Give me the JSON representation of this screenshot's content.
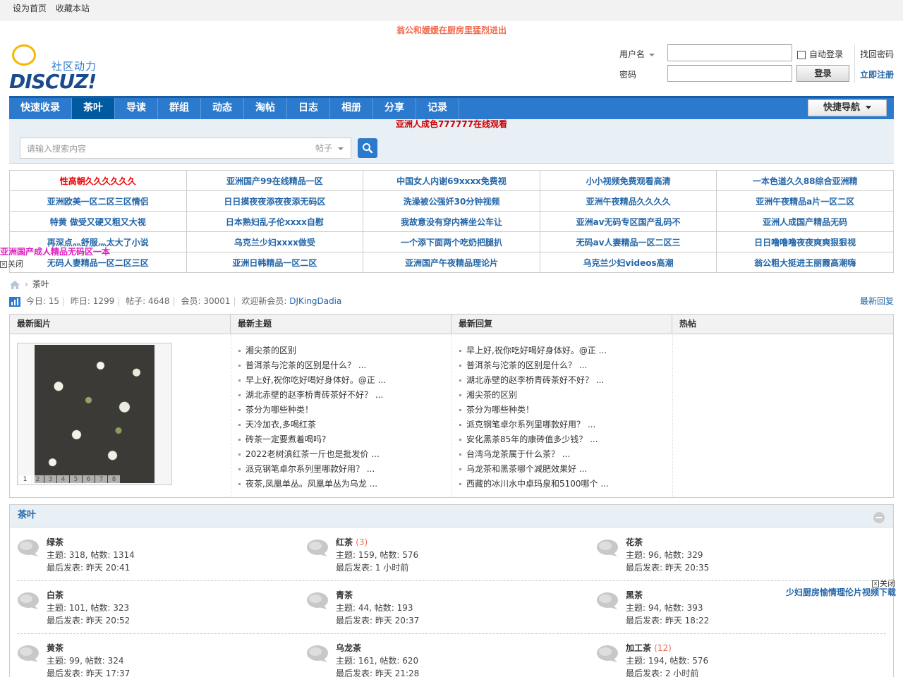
{
  "topbar": {
    "set_home": "设为首页",
    "bookmark": "收藏本站"
  },
  "top_ad": "翁公和媛媛在厨房里猛烈进出",
  "logo": {
    "slogan": "社区动力",
    "word": "DISCUZ!"
  },
  "login": {
    "username_label": "用户名",
    "password_label": "密码",
    "auto_login": "自动登录",
    "login_button": "登录",
    "find_password": "找回密码",
    "register": "立即注册"
  },
  "nav": {
    "items": [
      "快速收录",
      "茶叶",
      "导读",
      "群组",
      "动态",
      "淘帖",
      "日志",
      "相册",
      "分享",
      "记录"
    ],
    "quick_nav": "快捷导航"
  },
  "nav_ad": "亚洲人成色777777在线观看",
  "search": {
    "placeholder": "请输入搜索内容",
    "scope": "帖子"
  },
  "link_ads": [
    [
      "性高朝久久久久久久",
      "亚洲国产99在线精品一区",
      "中国女人内谢69xxxx免费视",
      "小小视频免费观看高清",
      "一本色道久久88综合亚洲精"
    ],
    [
      "亚洲欧美一区二区三区情侣",
      "日日摸夜夜添夜夜添无码区",
      "洗澡被公强奷30分钟视频",
      "亚洲午夜精品久久久久",
      "亚洲午夜精品a片一区二区"
    ],
    [
      "特黄 做受又硬又粗又大视",
      "日本熟妇乱子伦xxxx自慰",
      "我故意没有穿内裤坐公车让",
      "亚洲av无码专区国产乱码不",
      "亚洲人成国产精品无码"
    ],
    [
      "再深点灬舒服灬太大了小说",
      "乌克兰少妇xxxx做受",
      "一个添下面两个吃奶把腿扒",
      "无码av人妻精品一区二区三",
      "日日噜噜噜夜夜爽爽狠狠视"
    ],
    [
      "无码人妻精品一区二区三区",
      "亚洲日韩精品一区二区",
      "亚洲国产午夜精品理论片",
      "乌克兰少妇videos高潮",
      "翁公粗大挺进王丽霞高潮嗨"
    ]
  ],
  "float_left": {
    "text": "亚洲国产成人精品无码区一本",
    "close": "关闭"
  },
  "float_right": {
    "text": "少妇厨房愉情理伦片视频下载",
    "close": "关闭"
  },
  "breadcrumb": {
    "current": "茶叶"
  },
  "stats": {
    "today_label": "今日:",
    "today": "15",
    "yesterday_label": "昨日:",
    "yesterday": "1299",
    "posts_label": "帖子:",
    "posts": "4648",
    "members_label": "会员:",
    "members": "30001",
    "welcome_label": "欢迎新会员:",
    "new_member": "DJKingDadia",
    "latest_replies": "最新回复"
  },
  "widget": {
    "headers": [
      "最新图片",
      "最新主题",
      "最新回复",
      "热帖"
    ],
    "pager": [
      "1",
      "2",
      "3",
      "4",
      "5",
      "6",
      "7",
      "8"
    ],
    "latest_topics": [
      "湘尖茶的区别",
      "普洱茶与沱茶的区别是什么？ ...",
      "早上好,祝你吃好喝好身体好。@正 ...",
      "湖北赤壁的赵李桥青砖茶好不好？ ...",
      "茶分为哪些种类！",
      "天冷加衣,多喝红茶",
      "砖茶一定要煮着喝吗?",
      "2022老树滇红茶一斤也是批发价 ...",
      "派克钢笔卓尔系列里哪款好用？ ...",
      "夜茶,凤凰单丛。凤凰单丛为乌龙 ..."
    ],
    "latest_replies": [
      "早上好,祝你吃好喝好身体好。@正 ...",
      "普洱茶与沱茶的区别是什么？ ...",
      "湖北赤壁的赵李桥青砖茶好不好？ ...",
      "湘尖茶的区别",
      "茶分为哪些种类！",
      "派克钢笔卓尔系列里哪款好用？ ...",
      "安化黑茶85年的康砖值多少钱？ ...",
      "台湾乌龙茶属于什么茶？ ...",
      "乌龙茶和黑茶哪个减肥效果好 ...",
      "西藏的冰川水中卓玛泉和5100哪个 ..."
    ]
  },
  "forums": {
    "title": "茶叶",
    "items": [
      {
        "name": "绿茶",
        "new": "",
        "stats": "主题: 318, 帖数: 1314",
        "last": "最后发表: 昨天 20:41"
      },
      {
        "name": "红茶",
        "new": "(3)",
        "stats": "主题: 159, 帖数: 576",
        "last": "最后发表: 1 小时前"
      },
      {
        "name": "花茶",
        "new": "",
        "stats": "主题: 96, 帖数: 329",
        "last": "最后发表: 昨天 20:35"
      },
      {
        "name": "白茶",
        "new": "",
        "stats": "主题: 101, 帖数: 323",
        "last": "最后发表: 昨天 20:52"
      },
      {
        "name": "青茶",
        "new": "",
        "stats": "主题: 44, 帖数: 193",
        "last": "最后发表: 昨天 20:37"
      },
      {
        "name": "黑茶",
        "new": "",
        "stats": "主题: 94, 帖数: 393",
        "last": "最后发表: 昨天 18:22"
      },
      {
        "name": "黄茶",
        "new": "",
        "stats": "主题: 99, 帖数: 324",
        "last": "最后发表: 昨天 17:37"
      },
      {
        "name": "乌龙茶",
        "new": "",
        "stats": "主题: 161, 帖数: 620",
        "last": "最后发表: 昨天 21:28"
      },
      {
        "name": "加工茶",
        "new": "(12)",
        "stats": "主题: 194, 帖数: 576",
        "last": "最后发表: 2 小时前"
      }
    ]
  },
  "colors": {
    "nav_blue": "#2b7acd",
    "link_blue": "#2366a8",
    "ad_red": "#e00000",
    "new_count_orange": "#f26c4f"
  },
  "icons": [
    "home-icon",
    "search-icon",
    "stats-icon",
    "forum-bubble-icon",
    "collapse-icon",
    "close-icon"
  ]
}
